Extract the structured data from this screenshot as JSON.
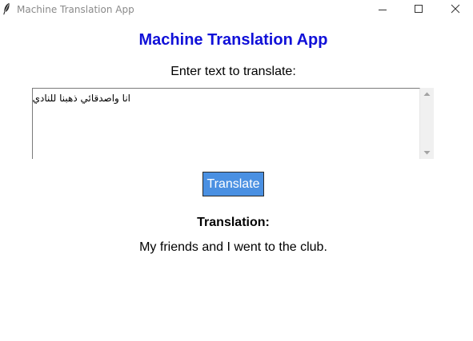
{
  "window": {
    "title": "Machine Translation App",
    "icon": "feather-icon"
  },
  "controls": {
    "minimize_icon": "minimize-icon",
    "maximize_icon": "maximize-icon",
    "close_icon": "close-icon"
  },
  "main": {
    "heading": "Machine Translation App",
    "heading_color": "#1010d8",
    "prompt": "Enter text to translate:",
    "input_text": "انا واصدقائي ذهبنا للنادي",
    "translate_label": "Translate",
    "translate_button_color": "#4a90e2",
    "result_label": "Translation:",
    "result_text": "My friends and I went to the club."
  }
}
